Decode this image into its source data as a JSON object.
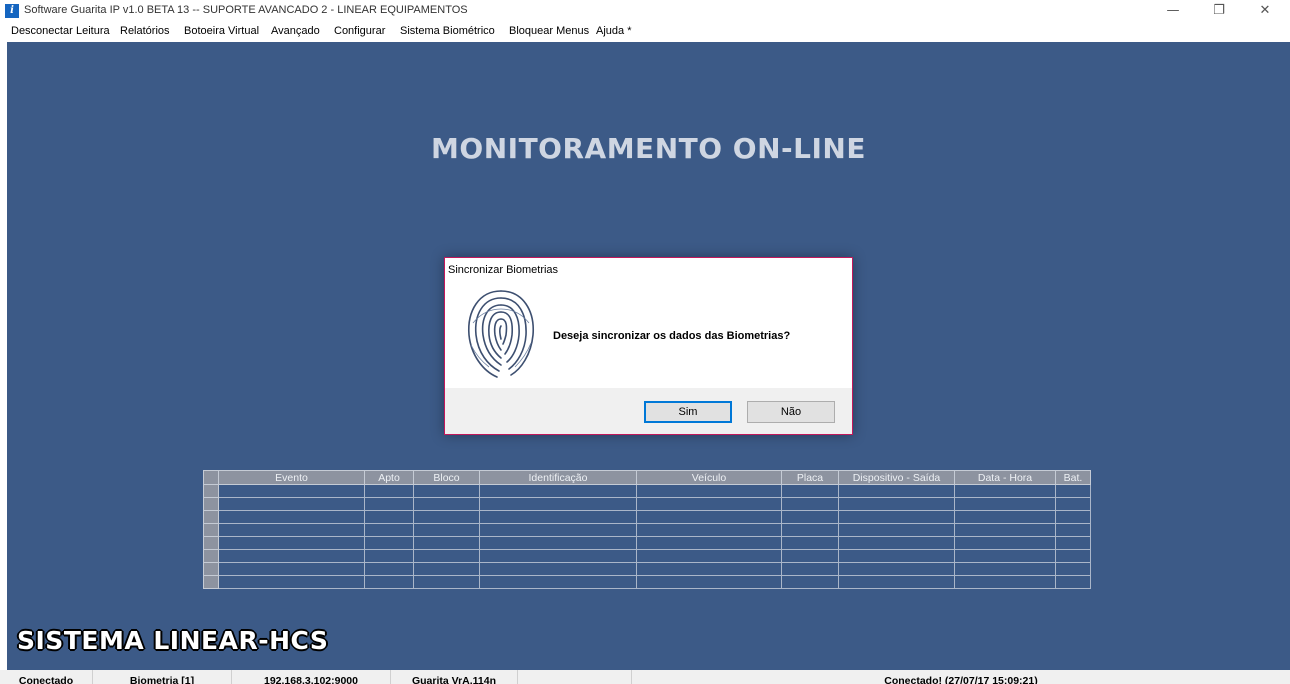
{
  "window": {
    "title": "Software Guarita IP v1.0 BETA 13 -- SUPORTE AVANCADO 2 - LINEAR EQUIPAMENTOS",
    "app_icon": "info-icon",
    "controls": {
      "minimize": "—",
      "restore": "❐",
      "close": "✕"
    }
  },
  "menu": [
    "Desconectar",
    "Leitura",
    "Relatórios",
    "Botoeira Virtual",
    "Avançado",
    "Configurar",
    "Sistema Biométrico",
    "Bloquear Menus",
    "Ajuda *"
  ],
  "main": {
    "title": "MONITORAMENTO ON-LINE",
    "brand": "SISTEMA LINEAR-HCS",
    "background_color": "#3c5a87"
  },
  "grid": {
    "columns": [
      "Evento",
      "Apto",
      "Bloco",
      "Identificação",
      "Veículo",
      "Placa",
      "Dispositivo - Saída",
      "Data - Hora",
      "Bat."
    ],
    "rows": [
      [
        "",
        "",
        "",
        "",
        "",
        "",
        "",
        "",
        ""
      ],
      [
        "",
        "",
        "",
        "",
        "",
        "",
        "",
        "",
        ""
      ],
      [
        "",
        "",
        "",
        "",
        "",
        "",
        "",
        "",
        ""
      ],
      [
        "",
        "",
        "",
        "",
        "",
        "",
        "",
        "",
        ""
      ],
      [
        "",
        "",
        "",
        "",
        "",
        "",
        "",
        "",
        ""
      ],
      [
        "",
        "",
        "",
        "",
        "",
        "",
        "",
        "",
        ""
      ],
      [
        "",
        "",
        "",
        "",
        "",
        "",
        "",
        "",
        ""
      ],
      [
        "",
        "",
        "",
        "",
        "",
        "",
        "",
        "",
        ""
      ]
    ]
  },
  "dialog": {
    "title": "Sincronizar Biometrias",
    "message": "Deseja sincronizar os dados das Biometrias?",
    "icon": "fingerprint-icon",
    "buttons": {
      "yes": "Sim",
      "no": "Não"
    }
  },
  "status": {
    "cells": [
      "Conectado",
      "Biometria [1]",
      "192.168.3.102:9000",
      "Guarita VrA.114n",
      "",
      "Conectado! (27/07/17 15:09:21)"
    ]
  }
}
